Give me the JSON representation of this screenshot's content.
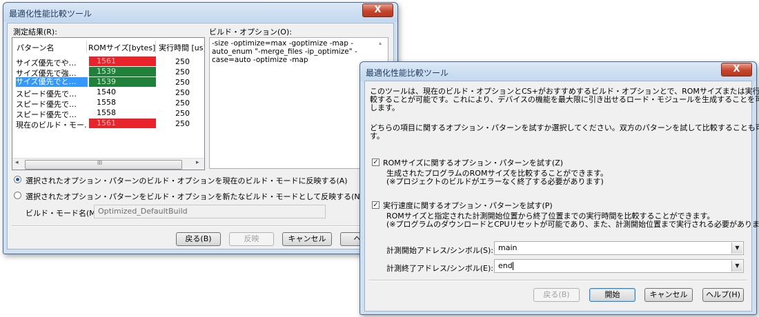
{
  "colors": {
    "rom_red": "#e8232b",
    "rom_green": "#20823a",
    "selection": "#3399ff"
  },
  "window1": {
    "title": "最適化性能比較ツール",
    "close_glyph": "X",
    "results_label": "測定結果(R):",
    "columns": [
      "パターン名",
      "ROMサイズ[bytes]",
      "実行時間 [us]"
    ],
    "rows": [
      {
        "name": "サイズ優先でや…",
        "rom": "1561",
        "time": "250",
        "rom_color": "red",
        "selected": false
      },
      {
        "name": "サイズ優先で強…",
        "rom": "1539",
        "time": "250",
        "rom_color": "green",
        "selected": false
      },
      {
        "name": "サイズ優先でと…",
        "rom": "1539",
        "time": "250",
        "rom_color": "green",
        "selected": true
      },
      {
        "name": "スピード優先で…",
        "rom": "1540",
        "time": "250",
        "rom_color": "none",
        "selected": false
      },
      {
        "name": "スピード優先で…",
        "rom": "1558",
        "time": "250",
        "rom_color": "none",
        "selected": false
      },
      {
        "name": "スピード優先で…",
        "rom": "1558",
        "time": "250",
        "rom_color": "none",
        "selected": false
      },
      {
        "name": "現在のビルド・モー…",
        "rom": "1561",
        "time": "250",
        "rom_color": "red",
        "selected": false
      }
    ],
    "scroll_thumb_glyph": "III",
    "scroll_left": "◂",
    "scroll_right": "▸",
    "build_option_label": "ビルド・オプション(O):",
    "build_option_text": "-size -optimize=max -goptimize -map -\nauto_enum \"-merge_files -ip_optimize\" -\ncase=auto -optimize -map",
    "radio1_label": "選択されたオプション・パターンのビルド・オプションを現在のビルド・モードに反映する(A)",
    "radio2_label": "選択されたオプション・パターンをビルド・オプションを新たなビルド・モードとして反映する(N)",
    "build_mode_label": "ビルド・モード名(M):",
    "build_mode_value": "Optimized_DefaultBuild",
    "buttons": {
      "back": "戻る(B)",
      "apply": "反映",
      "cancel": "キャンセル",
      "help": "ヘルプ"
    }
  },
  "window2": {
    "title": "最適化性能比較ツール",
    "close_glyph": "X",
    "intro": "このツールは、現在のビルド・オプションとCS+がおすすめするビルド・オプションとで、ROMサイズまたは実行速度を比\n較することが可能です。これにより、デバイスの機能を最大限に引き出せるロード・モジュールを生成することを可能に\nします。",
    "choose": "どちらの項目に関するオプション・パターンを試すか選択してください。双方のパターンを試して比較することも可能で\nす。",
    "check_rom_label": "ROMサイズに関するオプション・パターンを試す(Z)",
    "check_rom_checked": true,
    "check_rom_desc": "生成されたプログラムのROMサイズを比較することができます。\n(※プロジェクトのビルドがエラーなく終了する必要があります)",
    "check_speed_label": "実行速度に関するオプション・パターンを試す(P)",
    "check_speed_checked": true,
    "check_speed_desc": "ROMサイズと指定された計測開始位置から終了位置までの実行時間を比較することができます。\n(※プログラムのダウンロードとCPUリセットが可能であり、また、計測開始位置まで実行される必要があります)",
    "start_label": "計測開始アドレス/シンボル(S):",
    "start_value": "main",
    "end_label": "計測終了アドレス/シンボル(E):",
    "end_value": "end",
    "combo_arrow": "▼",
    "check_glyph": "✓",
    "buttons": {
      "back": "戻る(B)",
      "start": "開始",
      "cancel": "キャンセル",
      "help": "ヘルプ(H)"
    }
  }
}
